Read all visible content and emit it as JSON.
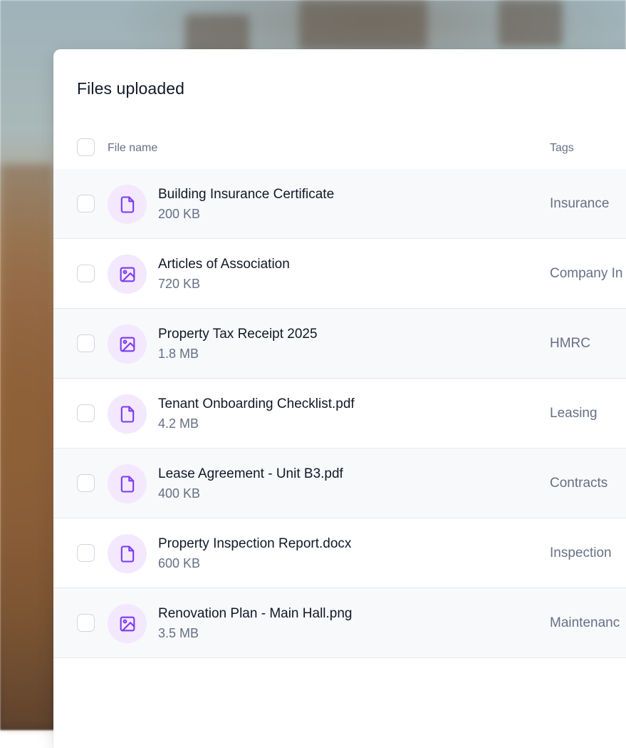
{
  "panel": {
    "title": "Files uploaded"
  },
  "table": {
    "columns": {
      "file_name": "File name",
      "tags": "Tags"
    },
    "rows": [
      {
        "name": "Building Insurance Certificate",
        "size": "200 KB",
        "tag": "Insurance",
        "icon": "document-icon"
      },
      {
        "name": "Articles of Association",
        "size": "720 KB",
        "tag": "Company In",
        "icon": "image-icon"
      },
      {
        "name": "Property Tax Receipt 2025",
        "size": "1.8 MB",
        "tag": "HMRC",
        "icon": "image-icon"
      },
      {
        "name": "Tenant Onboarding Checklist.pdf",
        "size": "4.2 MB",
        "tag": "Leasing",
        "icon": "document-icon"
      },
      {
        "name": "Lease Agreement - Unit B3.pdf",
        "size": "400 KB",
        "tag": "Contracts",
        "icon": "document-icon"
      },
      {
        "name": "Property Inspection Report.docx",
        "size": "600 KB",
        "tag": "Inspection",
        "icon": "document-icon"
      },
      {
        "name": "Renovation Plan - Main Hall.png",
        "size": "3.5 MB",
        "tag": "Maintenanc",
        "icon": "image-icon"
      }
    ]
  },
  "colors": {
    "icon_accent": "#7c3aed",
    "icon_background": "#f3e8fd",
    "alt_row_background": "#f8f9fb"
  }
}
